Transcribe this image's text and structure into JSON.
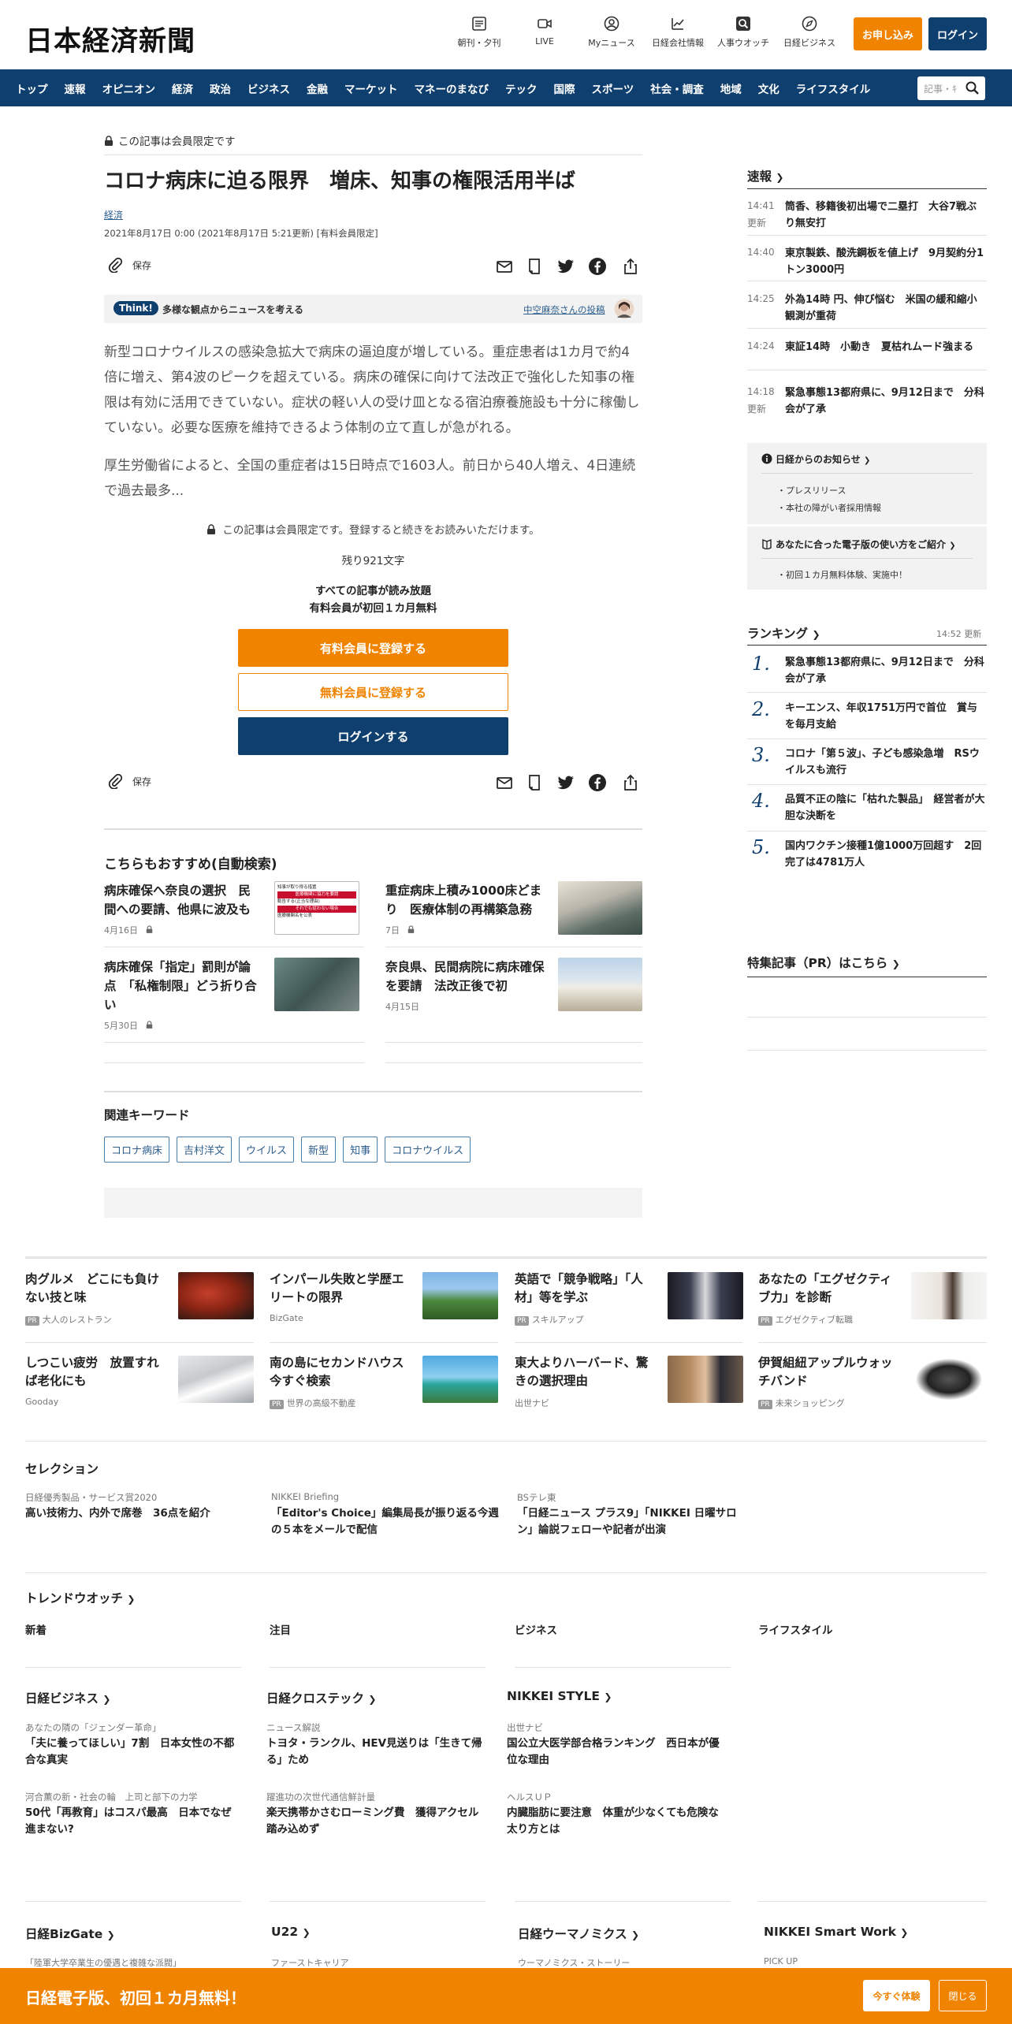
{
  "header": {
    "logo": "日本経済新聞",
    "icons": [
      {
        "label": "朝刊・夕刊",
        "icon": "newspaper-icon"
      },
      {
        "label": "LIVE",
        "icon": "video-icon"
      },
      {
        "label": "Myニュース",
        "icon": "user-icon"
      },
      {
        "label": "日経会社情報",
        "icon": "chart-icon"
      },
      {
        "label": "人事ウオッチ",
        "icon": "search-person-icon"
      },
      {
        "label": "日経ビジネス",
        "icon": "compass-icon"
      }
    ],
    "subscribe": "お申し込み",
    "login": "ログイン"
  },
  "nav": {
    "items": [
      "トップ",
      "速報",
      "オピニオン",
      "経済",
      "政治",
      "ビジネス",
      "金融",
      "マーケット",
      "マネーのまなび",
      "テック",
      "国際",
      "スポーツ",
      "社会・調査",
      "地域",
      "文化",
      "ライフスタイル"
    ],
    "search_placeholder": "記事・ｷ"
  },
  "article": {
    "member_only": "この記事は会員限定です",
    "title": "コロナ病床に迫る限界　増床、知事の権限活用半ば",
    "category": "経済",
    "date": "2021年8月17日 0:00 (2021年8月17日 5:21更新) [有料会員限定]",
    "save": "保存",
    "think_badge": "Think!",
    "think_text": "多様な観点からニュースを考える",
    "think_author": "中空麻奈さんの投稿",
    "p1": "新型コロナウイルスの感染急拡大で病床の逼迫度が増している。重症患者は1カ月で約4倍に増え、第4波のピークを超えている。病床の確保に向けて法改正で強化した知事の権限は有効に活用できていない。症状の軽い人の受け皿となる宿泊療養施設も十分に稼働していない。必要な医療を維持できるよう体制の立て直しが急がれる。",
    "p2": "厚生労働省によると、全国の重症者は15日時点で1603人。前日から40人増え、4日連続で過去最多...",
    "paywall": "この記事は会員限定です。登録すると続きをお読みいただけます。",
    "remaining": "残り921文字",
    "offer1": "すべての記事が読み放題",
    "offer2": "有料会員が初回１カ月無料",
    "btn_paid": "有料会員に登録する",
    "btn_free": "無料会員に登録する",
    "btn_login": "ログインする",
    "save2": "保存"
  },
  "recommend": {
    "heading": "こちらもおすすめ(自動検索)",
    "items": [
      {
        "title": "病床確保へ奈良の選択　民間への要請、他県に波及も",
        "date": "4月16日"
      },
      {
        "title": "重症病床上積み1000床どまり　医療体制の再構築急務",
        "date": "7日"
      },
      {
        "title": "病床確保「指定」罰則が論点　「私権制限」どう折り合い",
        "date": "5月30日"
      },
      {
        "title": "奈良県、民間病院に病床確保を要請　法改正後で初",
        "date": "4月15日"
      }
    ],
    "thumb1_lines": [
      "知事が取り得る措置",
      "医療機関に協力を要請",
      "勧告する(正当な理由)",
      "それでも従わない場合",
      "医療機関名を公表"
    ]
  },
  "keywords": {
    "heading": "関連キーワード",
    "items": [
      "コロナ病床",
      "吉村洋文",
      "ウイルス",
      "新型",
      "知事",
      "コロナウイルス"
    ]
  },
  "sidebar": {
    "flash_heading": "速報",
    "flash": [
      {
        "time": "14:41",
        "updated": "更新",
        "text": "筒香、移籍後初出場で二塁打　大谷7戦ぶり無安打"
      },
      {
        "time": "14:40",
        "updated": "",
        "text": "東京製鉄、酸洗鋼板を値上げ　9月契約分1トン3000円"
      },
      {
        "time": "14:25",
        "updated": "",
        "text": "外為14時 円、伸び悩む　米国の緩和縮小観測が重荷"
      },
      {
        "time": "14:24",
        "updated": "",
        "text": "東証14時　小動き　夏枯れムード強まる"
      },
      {
        "time": "14:18",
        "updated": "更新",
        "text": "緊急事態13都府県に、9月12日まで　分科会が了承"
      }
    ],
    "notice_heading": "日経からのお知らせ",
    "notice_items": [
      "プレスリリース",
      "本社の障がい者採用情報"
    ],
    "guide_heading": "あなたに合った電子版の使い方をご紹介",
    "guide_items": [
      "初回１カ月無料体験、実施中！"
    ],
    "ranking_heading": "ランキング",
    "ranking_time": "14:52  更新",
    "ranking": [
      {
        "n": "1.",
        "text": "緊急事態13都府県に、9月12日まで　分科会が了承"
      },
      {
        "n": "2.",
        "text": "キーエンス、年収1751万円で首位　賞与を毎月支給"
      },
      {
        "n": "3.",
        "text": "コロナ「第５波」、子ども感染急増　RSウイルスも流行"
      },
      {
        "n": "4.",
        "text": "品質不正の陰に「枯れた製品」　経営者が大胆な決断を"
      },
      {
        "n": "5.",
        "text": "国内ワクチン接種1億1000万回超す　2回完了は4781万人"
      }
    ],
    "pr_heading": "特集記事（PR）はこちら"
  },
  "promo": {
    "items": [
      {
        "title": "肉グルメ　どこにも負けない技と味",
        "pr": true,
        "source": "大人のレストラン"
      },
      {
        "title": "インパール失敗と学歴エリートの限界",
        "pr": false,
        "source": "BizGate"
      },
      {
        "title": "英語で「競争戦略」「人材」等を学ぶ",
        "pr": true,
        "source": "スキルアップ"
      },
      {
        "title": "あなたの「エグゼクティブ力」を診断",
        "pr": true,
        "source": "エグゼクティブ転職"
      },
      {
        "title": "しつこい疲労　放置すれば老化にも",
        "pr": false,
        "source": "Gooday"
      },
      {
        "title": "南の島にセカンドハウス　今すぐ検索",
        "pr": true,
        "source": "世界の高級不動産"
      },
      {
        "title": "東大よりハーバード、驚きの選択理由",
        "pr": false,
        "source": "出世ナビ"
      },
      {
        "title": "伊賀組紐アップルウォッチバンド",
        "pr": true,
        "source": "未来ショッピング"
      }
    ],
    "pr_label": "PR"
  },
  "selection": {
    "heading": "セレクション",
    "items": [
      {
        "cat": "日経優秀製品・サービス賞2020",
        "title": "高い技術力、内外で席巻　36点を紹介"
      },
      {
        "cat": "NIKKEI Briefing",
        "title": "「Editor's Choice」編集局長が振り返る今週の５本をメールで配信"
      },
      {
        "cat": "BSテレ東",
        "title": "「日経ニュース プラス9」「NIKKEI 日曜サロン」論説フェローや記者が出演"
      }
    ]
  },
  "trend": {
    "heading": "トレンドウオッチ",
    "tabs": [
      "新着",
      "注目",
      "ビジネス",
      "ライフスタイル"
    ]
  },
  "media": {
    "cols": [
      {
        "heading": "日経ビジネス",
        "items": [
          {
            "cat": "あなたの隣の「ジェンダー革命」",
            "title": "「夫に養ってほしい」7割　日本女性の不都合な真実"
          },
          {
            "cat": "河合薫の新・社会の輪　上司と部下の力学",
            "title": "50代「再教育」はコスパ最高　日本でなぜ進まない?"
          }
        ]
      },
      {
        "heading": "日経クロステック",
        "items": [
          {
            "cat": "ニュース解説",
            "title": "トヨタ・ランクル、HEV見送りは「生きて帰る」ため"
          },
          {
            "cat": "躍進功の次世代通信鮮計量",
            "title": "楽天携帯かさむローミング費　獲得アクセル踏み込めず"
          }
        ]
      },
      {
        "heading": "NIKKEI STYLE",
        "items": [
          {
            "cat": "出世ナビ",
            "title": "国公立大医学部合格ランキング　西日本が優位な理由"
          },
          {
            "cat": "ヘルスＵＰ",
            "title": "内臓脂肪に要注意　体重が少なくても危険な太り方とは"
          }
        ]
      }
    ],
    "cols2": [
      {
        "heading": "日経BizGate",
        "cat": "「陸軍大学卒業生の優遇と複雑な派閥」"
      },
      {
        "heading": "U22",
        "cat": "ファーストキャリア"
      },
      {
        "heading": "日経ウーマノミクス",
        "cat": "ウーマノミクス・ストーリー"
      },
      {
        "heading": "NIKKEI Smart Work",
        "cat": "PICK UP"
      }
    ]
  },
  "banner": {
    "text": "日経電子版、初回１カ月無料！",
    "try": "今すぐ体験",
    "close": "閉じる"
  },
  "colors": {
    "navy": "#0f3f6e",
    "orange": "#f08300"
  }
}
